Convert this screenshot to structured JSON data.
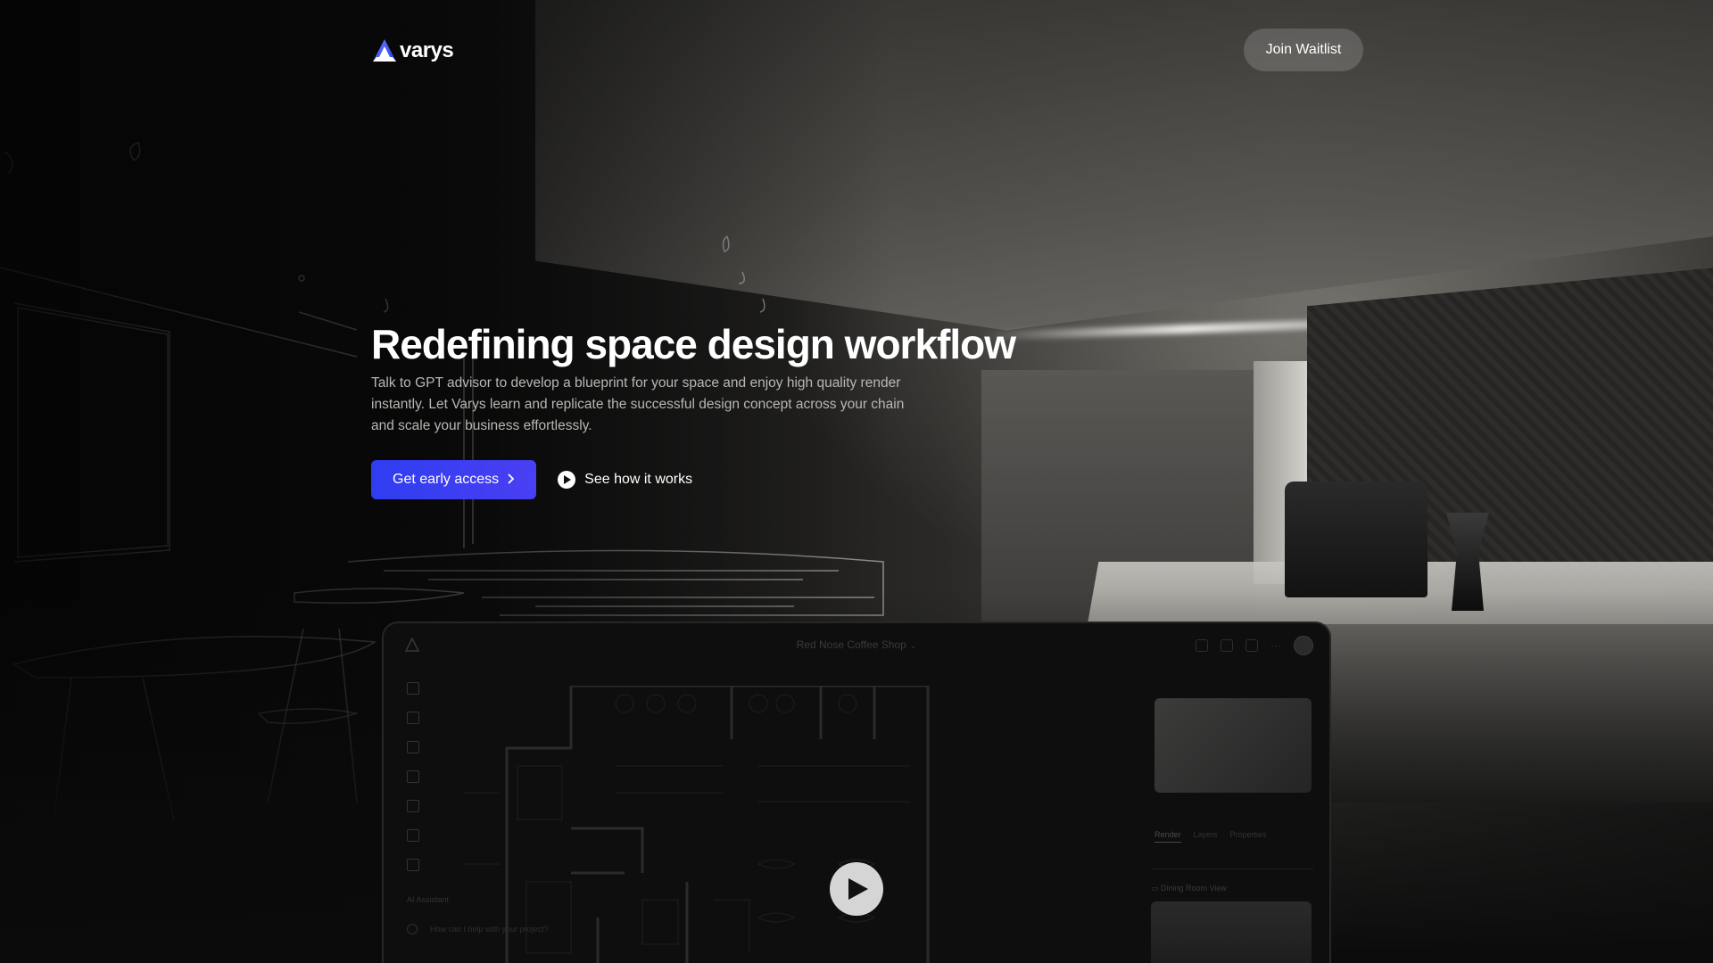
{
  "brand": {
    "name": "varys",
    "logo_icon": "varys-triangle-logo",
    "accent": "#3b3ff2"
  },
  "header": {
    "cta_label": "Join Waitlist"
  },
  "hero": {
    "title": "Redefining space design workflow",
    "subtitle": "Talk to GPT advisor to develop a blueprint for your space and enjoy high quality render instantly. Let Varys learn and replicate the successful design concept across your chain and scale your business effortlessly.",
    "primary_cta": "Get early access",
    "primary_cta_icon": "chevron-right-icon",
    "secondary_cta": "See how it works",
    "secondary_cta_icon": "play-circle-icon"
  },
  "preview": {
    "project_title": "Red Nose Coffee Shop",
    "tools": [
      "layout-icon",
      "cursor-icon",
      "grid-icon",
      "bed-icon",
      "cube-icon",
      "frame-icon",
      "camera-icon"
    ],
    "panel_tabs": [
      "Render",
      "Layers",
      "Properties"
    ],
    "view_label": "Dining Room View",
    "assistant_title": "AI Assistant",
    "assistant_placeholder": "How can I help with your project?",
    "play_icon": "play-icon"
  }
}
